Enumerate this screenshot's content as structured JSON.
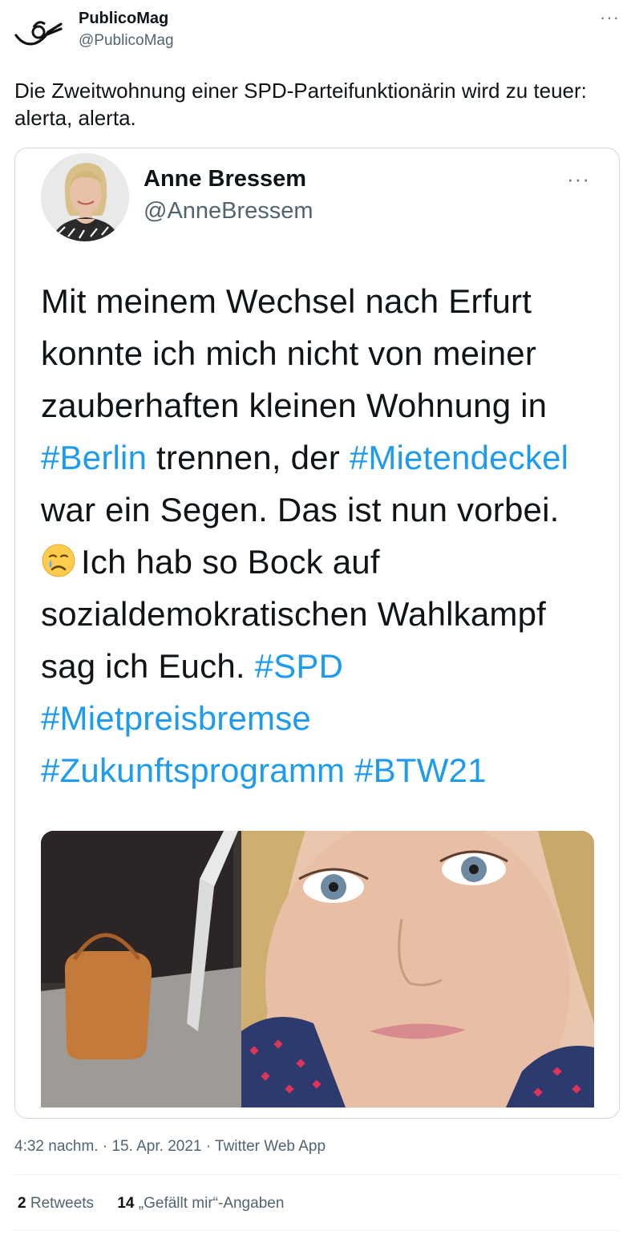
{
  "outer_tweet": {
    "display_name": "PublicoMag",
    "handle": "@PublicoMag",
    "more_label": "···",
    "text": "Die Zweitwohnung einer SPD-Parteifunktionärin wird zu teuer: alerta, alerta."
  },
  "quoted_tweet": {
    "display_name": "Anne Bressem",
    "handle": "@AnneBressem",
    "more_label": "···",
    "text_parts": {
      "p1": "Mit meinem Wechsel nach Erfurt konnte ich mich nicht von meiner zauberhaften kleinen Wohnung in ",
      "tag_berlin": "#Berlin",
      "p2": " trennen, der ",
      "tag_mietendeckel": "#Mietendeckel",
      "p3": " war ein Segen. Das ist nun vorbei. ",
      "p4": "Ich hab so Bock auf sozialdemokratischen Wahlkampf sag ich Euch. ",
      "tag_spd": "#SPD",
      "tag_mietpreisbremse": "#Mietpreisbremse",
      "tag_zukunft": "#Zukunftsprogramm",
      "tag_btw": "#BTW21"
    },
    "emoji": "crying-face-emoji"
  },
  "meta": {
    "time": "4:32 nachm.",
    "separator": "·",
    "date": "15. Apr. 2021",
    "source": "Twitter Web App"
  },
  "stats": {
    "retweets_count": "2",
    "retweets_label": "Retweets",
    "likes_count": "14",
    "likes_label": "„Gefällt mir“-Angaben"
  },
  "colors": {
    "hashtag": "#1d9bf0",
    "secondary_text": "#536471",
    "border": "#cfd9de"
  }
}
